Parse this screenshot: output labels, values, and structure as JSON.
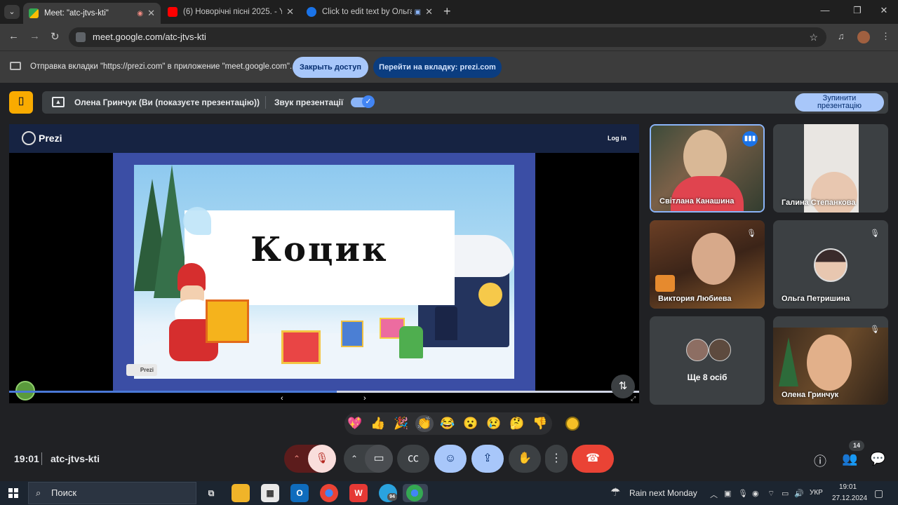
{
  "browser": {
    "tabs": [
      {
        "title": "Meet: \"atc-jtvs-kti\"",
        "active": true
      },
      {
        "title": "(6) Новорічні пісні 2025. - You",
        "active": false
      },
      {
        "title": "Click to edit text by Ольга Г",
        "active": false
      }
    ],
    "url": "meet.google.com/atc-jtvs-kti"
  },
  "infobar": {
    "message": "Отправка вкладки \"https://prezi.com\" в приложение \"meet.google.com\"...",
    "stop_label": "Закрыть доступ",
    "goto_label": "Перейти на вкладку: prezi.com"
  },
  "presenting": {
    "presenter_text": "Олена Гринчук (Ви (показуєте презентацію))",
    "audio_label": "Звук презентації",
    "stop_label_1": "Зупинити",
    "stop_label_2": "презентацію"
  },
  "prezi": {
    "brand": "Prezi",
    "login": "Log in",
    "slide_title": "Коцик",
    "chip_label": "Prezi",
    "progress": 0.52
  },
  "participants": [
    {
      "name": "Світлана Канашина",
      "speaking": true,
      "muted": false
    },
    {
      "name": "Галина Степанкова",
      "speaking": false,
      "muted": false
    },
    {
      "name": "Виктория Любиева",
      "speaking": false,
      "muted": true
    },
    {
      "name": "Ольга Петришина",
      "speaking": false,
      "muted": true
    },
    {
      "name": "Ще 8 осіб",
      "speaking": false,
      "muted": false
    },
    {
      "name": "Олена Гринчук",
      "speaking": false,
      "muted": true
    }
  ],
  "reactions": [
    "💖",
    "👍",
    "🎉",
    "👏",
    "😂",
    "😮",
    "😢",
    "🤔",
    "👎"
  ],
  "meeting": {
    "time": "19:01",
    "code": "atc-jtvs-kti",
    "participant_count": "14"
  },
  "taskbar": {
    "search_placeholder": "Поиск",
    "weather": "Rain next Monday",
    "lang": "УКР",
    "clock_time": "19:01",
    "clock_date": "27.12.2024",
    "telegram_badge": "94"
  },
  "colors": {
    "accent": "#8ab4f8",
    "end_call": "#ea4335",
    "mic_off": "#f9dedc"
  }
}
